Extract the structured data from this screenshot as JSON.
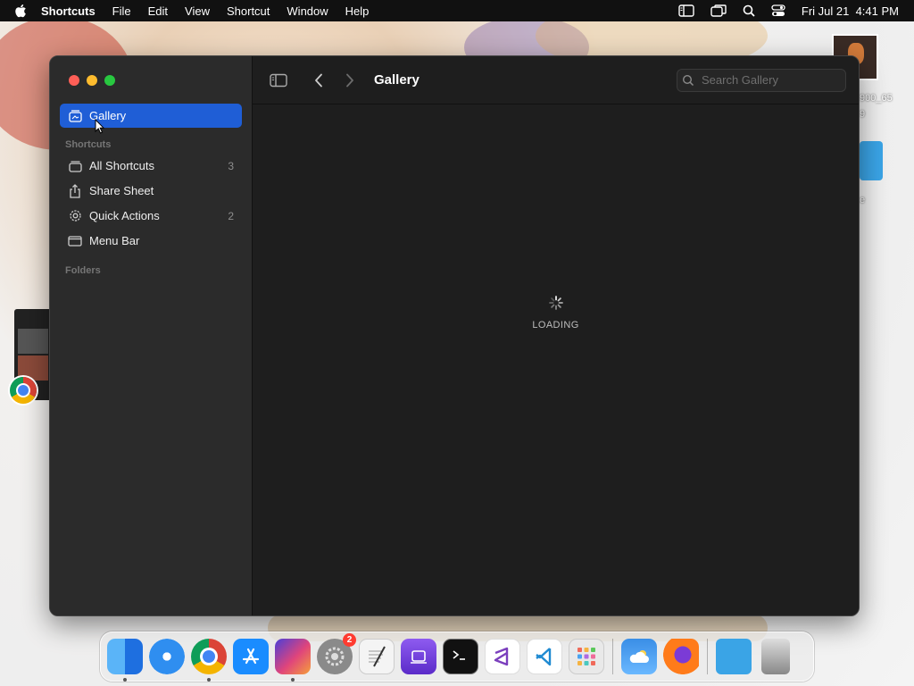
{
  "menubar": {
    "app_name": "Shortcuts",
    "items": [
      "File",
      "Edit",
      "View",
      "Shortcut",
      "Window",
      "Help"
    ],
    "datetime": "Fri Jul 21  4:41 PM"
  },
  "desktop": {
    "label_1": "900_65",
    "label_2": "9",
    "label_3": "e"
  },
  "window": {
    "toolbar": {
      "title": "Gallery",
      "search_placeholder": "Search Gallery"
    },
    "sidebar": {
      "gallery_label": "Gallery",
      "sections": {
        "shortcuts": "Shortcuts",
        "folders": "Folders"
      },
      "items": [
        {
          "label": "All Shortcuts",
          "count": "3",
          "icon": "stack-icon"
        },
        {
          "label": "Share Sheet",
          "count": "",
          "icon": "share-icon"
        },
        {
          "label": "Quick Actions",
          "count": "2",
          "icon": "gear-icon"
        },
        {
          "label": "Menu Bar",
          "count": "",
          "icon": "menubar-icon"
        }
      ]
    },
    "content": {
      "loading_text": "LOADING"
    }
  },
  "dock": {
    "settings_badge": "2"
  },
  "colors": {
    "accent": "#1f5ed6",
    "sidebar_bg": "#2b2b2b",
    "content_bg": "#1e1e1e"
  }
}
